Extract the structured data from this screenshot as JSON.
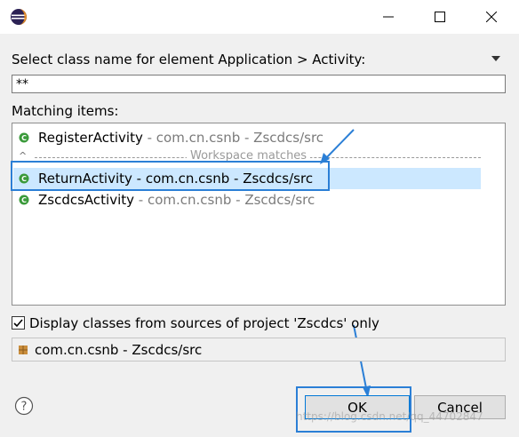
{
  "window": {
    "app_icon": "eclipse-icon",
    "controls": [
      "minimize-icon",
      "maximize-icon",
      "close-icon"
    ]
  },
  "dialog": {
    "prompt": "Select class name for element Application > Activity:",
    "filter_value": "**",
    "matching_label": "Matching items:",
    "items": [
      {
        "name": "RegisterActivity",
        "qualifier": " - com.cn.csnb - Zscdcs/src",
        "selected": false
      },
      {
        "name": "ReturnActivity",
        "qualifier": " - com.cn.csnb - Zscdcs/src",
        "selected": true
      },
      {
        "name": "ZscdcsActivity",
        "qualifier": " - com.cn.csnb - Zscdcs/src",
        "selected": false
      }
    ],
    "separator_label": "Workspace matches",
    "checkbox_label": "Display classes from sources of project 'Zscdcs' only",
    "checkbox_checked": true,
    "package_value": "com.cn.csnb - Zscdcs/src",
    "ok_label": "OK",
    "cancel_label": "Cancel"
  },
  "watermark": "https://blog.csdn.net/qq_44702847",
  "colors": {
    "selection": "#cce8ff",
    "annotation": "#2b7fd6",
    "class_icon": "#3a9a3a"
  }
}
